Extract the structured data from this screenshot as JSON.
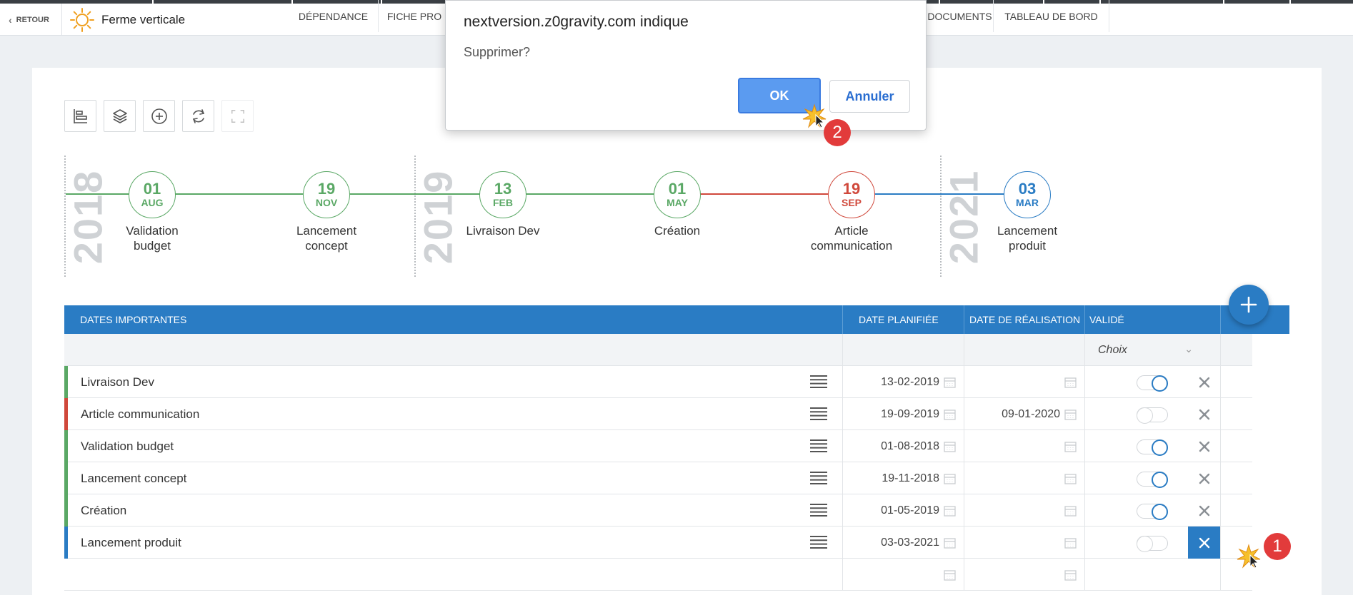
{
  "nav": {
    "back_label": "RETOUR",
    "project_title": "Ferme verticale",
    "items": [
      {
        "label": "DÉPENDANCE"
      },
      {
        "label": "FICHE PRO"
      },
      {
        "label": "DOCUMENTS"
      },
      {
        "label": "TABLEAU DE BORD"
      }
    ]
  },
  "timeline": {
    "years": [
      "2018",
      "2019",
      "2021"
    ],
    "milestones": [
      {
        "day": "01",
        "month": "AUG",
        "label": "Validation budget",
        "color": "#5aa865"
      },
      {
        "day": "19",
        "month": "NOV",
        "label": "Lancement concept",
        "color": "#5aa865"
      },
      {
        "day": "13",
        "month": "FEB",
        "label": "Livraison Dev",
        "color": "#5aa865"
      },
      {
        "day": "01",
        "month": "MAY",
        "label": "Création",
        "color": "#5aa865"
      },
      {
        "day": "19",
        "month": "SEP",
        "label": "Article communication",
        "color": "#d0483b"
      },
      {
        "day": "03",
        "month": "MAR",
        "label": "Lancement produit",
        "color": "#2a7cc4"
      }
    ]
  },
  "table": {
    "headers": {
      "name": "DATES IMPORTANTES",
      "planned": "DATE PLANIFIÉE",
      "done": "DATE DE RÉALISATION",
      "validated": "VALIDÉ"
    },
    "filter_choice": "Choix",
    "rows": [
      {
        "name": "Livraison Dev",
        "planned": "13-02-2019",
        "done": "",
        "validated": true,
        "color": "#5aa865"
      },
      {
        "name": "Article communication",
        "planned": "19-09-2019",
        "done": "09-01-2020",
        "validated": false,
        "color": "#d0483b"
      },
      {
        "name": "Validation budget",
        "planned": "01-08-2018",
        "done": "",
        "validated": true,
        "color": "#5aa865"
      },
      {
        "name": "Lancement concept",
        "planned": "19-11-2018",
        "done": "",
        "validated": true,
        "color": "#5aa865"
      },
      {
        "name": "Création",
        "planned": "01-05-2019",
        "done": "",
        "validated": true,
        "color": "#5aa865"
      },
      {
        "name": "Lancement produit",
        "planned": "03-03-2021",
        "done": "",
        "validated": false,
        "color": "#2a7cc4"
      }
    ]
  },
  "dialog": {
    "title": "nextversion.z0gravity.com indique",
    "message": "Supprimer?",
    "ok_label": "OK",
    "cancel_label": "Annuler"
  },
  "steps": {
    "one": "1",
    "two": "2"
  },
  "colors": {
    "primary": "#2a7cc4",
    "green": "#5aa865",
    "red": "#d0483b"
  }
}
